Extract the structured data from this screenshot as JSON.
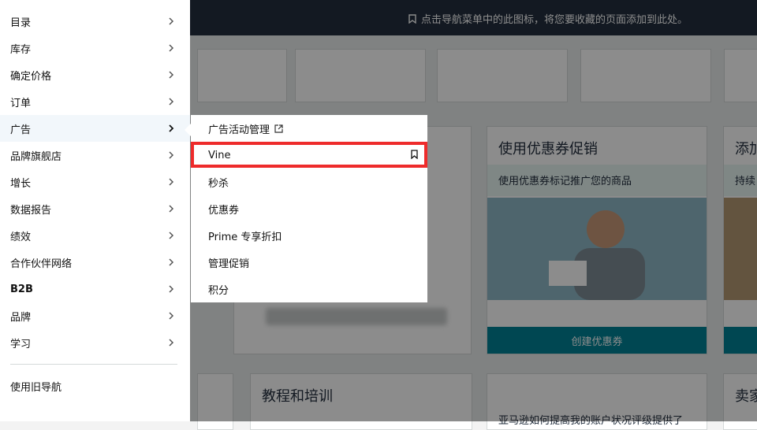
{
  "header": {
    "bookmark_hint": "点击导航菜单中的此图标，将您要收藏的页面添加到此处。"
  },
  "background": {
    "card_coupon_title": "使用优惠券促销",
    "card_coupon_sub": "使用优惠券标记推广您的商品",
    "card_coupon_button": "创建优惠券",
    "card_add_title": "添加",
    "card_add_sub": "持续",
    "card_training_title": "教程和培训",
    "card_seller_title": "卖家",
    "card_training_sub": "亚马逊如何提高我的账户状况评级提供了"
  },
  "sidebar": {
    "items": [
      {
        "label": "目录"
      },
      {
        "label": "库存"
      },
      {
        "label": "确定价格"
      },
      {
        "label": "订单"
      },
      {
        "label": "广告"
      },
      {
        "label": "品牌旗舰店"
      },
      {
        "label": "增长"
      },
      {
        "label": "数据报告"
      },
      {
        "label": "绩效"
      },
      {
        "label": "合作伙伴网络"
      },
      {
        "label": "B2B"
      },
      {
        "label": "品牌"
      },
      {
        "label": "学习"
      }
    ],
    "legacy_nav": "使用旧导航"
  },
  "flyout": {
    "items": [
      {
        "label": "广告活动管理"
      },
      {
        "label": "Vine"
      },
      {
        "label": "秒杀"
      },
      {
        "label": "优惠券"
      },
      {
        "label": "Prime 专享折扣"
      },
      {
        "label": "管理促销"
      },
      {
        "label": "积分"
      }
    ]
  },
  "colors": {
    "topbar": "#232f3e",
    "highlight": "#ee2b2b",
    "teal_button": "#008296"
  }
}
